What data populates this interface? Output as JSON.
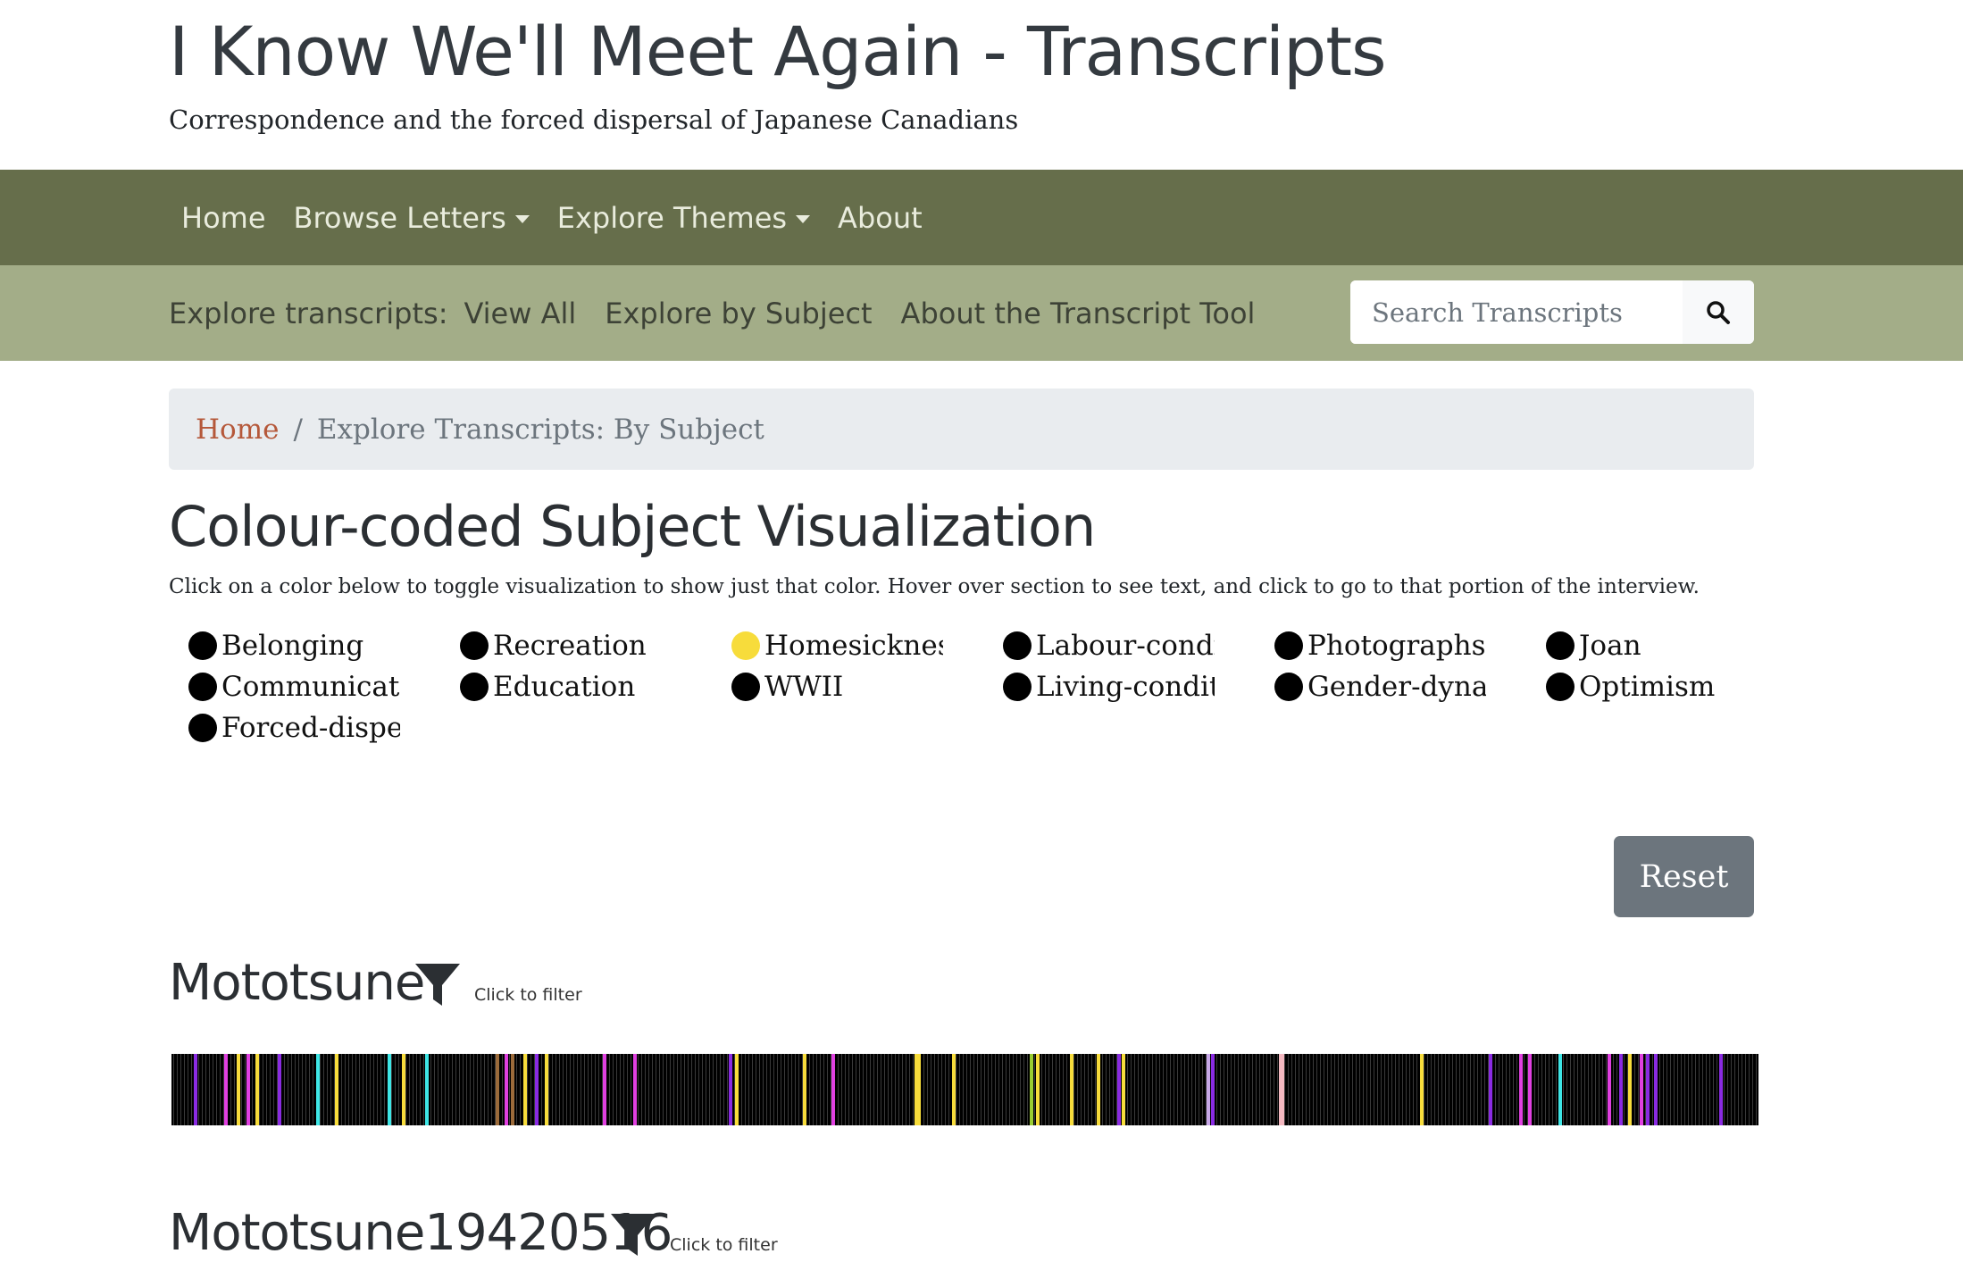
{
  "site": {
    "title": "I Know We'll Meet Again - Transcripts",
    "subtitle": "Correspondence and the forced dispersal of Japanese Canadians"
  },
  "main_nav": {
    "home": "Home",
    "browse_letters": "Browse Letters",
    "explore_themes": "Explore Themes",
    "about": "About"
  },
  "sub_nav": {
    "label": "Explore transcripts:",
    "view_all": "View All",
    "explore_by_subject": "Explore by Subject",
    "about_tool": "About the Transcript Tool",
    "search_placeholder": "Search Transcripts",
    "search_icon": "search-icon"
  },
  "breadcrumb": {
    "home": "Home",
    "separator": "/",
    "current": "Explore Transcripts: By Subject"
  },
  "page": {
    "title": "Colour-coded Subject Visualization",
    "instructions": "Click on a color below to toggle visualization to show just that color. Hover over section to see text, and click to go to that portion of the interview."
  },
  "legend": [
    {
      "label": "Belonging",
      "color": "#000000"
    },
    {
      "label": "Recreation",
      "color": "#000000"
    },
    {
      "label": "Homesickness",
      "color": "#f7dc3b"
    },
    {
      "label": "Labour-conditions",
      "color": "#000000"
    },
    {
      "label": "Photographs",
      "color": "#000000"
    },
    {
      "label": "Joan",
      "color": "#000000"
    },
    {
      "label": "Communication",
      "color": "#000000"
    },
    {
      "label": "Education",
      "color": "#000000"
    },
    {
      "label": "WWII",
      "color": "#000000"
    },
    {
      "label": "Living-conditions",
      "color": "#000000"
    },
    {
      "label": "Gender-dynamics",
      "color": "#000000"
    },
    {
      "label": "Optimism",
      "color": "#000000"
    },
    {
      "label": "Forced-dispersal",
      "color": "#000000"
    }
  ],
  "reset_label": "Reset",
  "sections": [
    {
      "name": "Mototsune",
      "filter_hint": "Click to filter",
      "filter_icon": "filter-icon"
    },
    {
      "name": "Mototsune19420516",
      "filter_hint": "Click to filter",
      "filter_icon": "filter-icon"
    }
  ],
  "colors": {
    "main_nav_bg": "#666e4b",
    "sub_nav_bg": "#a3ad88",
    "link_accent": "#b5583a",
    "reset_bg": "#6c757d",
    "highlight_yellow": "#f7dc3b",
    "highlight_magenta": "#e040e0",
    "highlight_purple": "#8a2be2",
    "highlight_cyan": "#3ee6e6",
    "highlight_brown": "#9c6b3a",
    "highlight_green": "#9acd32",
    "highlight_lavender": "#c8a8e8",
    "highlight_pink": "#f4b8c0"
  },
  "visualization_segments": [
    {
      "pos": 0.014,
      "color": "purple"
    },
    {
      "pos": 0.033,
      "color": "magenta"
    },
    {
      "pos": 0.041,
      "color": "yellow"
    },
    {
      "pos": 0.047,
      "color": "magenta"
    },
    {
      "pos": 0.053,
      "color": "yellow"
    },
    {
      "pos": 0.067,
      "color": "purple"
    },
    {
      "pos": 0.091,
      "color": "cyan"
    },
    {
      "pos": 0.103,
      "color": "yellow"
    },
    {
      "pos": 0.136,
      "color": "cyan"
    },
    {
      "pos": 0.145,
      "color": "yellow"
    },
    {
      "pos": 0.16,
      "color": "cyan"
    },
    {
      "pos": 0.204,
      "color": "brown"
    },
    {
      "pos": 0.21,
      "color": "magenta"
    },
    {
      "pos": 0.214,
      "color": "brown"
    },
    {
      "pos": 0.222,
      "color": "yellow"
    },
    {
      "pos": 0.229,
      "color": "purple"
    },
    {
      "pos": 0.235,
      "color": "yellow"
    },
    {
      "pos": 0.272,
      "color": "magenta"
    },
    {
      "pos": 0.291,
      "color": "magenta"
    },
    {
      "pos": 0.351,
      "color": "purple"
    },
    {
      "pos": 0.355,
      "color": "yellow"
    },
    {
      "pos": 0.398,
      "color": "yellow"
    },
    {
      "pos": 0.416,
      "color": "magenta"
    },
    {
      "pos": 0.468,
      "color": "yellow"
    },
    {
      "pos": 0.492,
      "color": "yellow"
    },
    {
      "pos": 0.47,
      "color": "yellow"
    },
    {
      "pos": 0.541,
      "color": "green"
    },
    {
      "pos": 0.566,
      "color": "yellow"
    },
    {
      "pos": 0.545,
      "color": "yellow"
    },
    {
      "pos": 0.596,
      "color": "purple"
    },
    {
      "pos": 0.599,
      "color": "yellow"
    },
    {
      "pos": 0.652,
      "color": "lavender"
    },
    {
      "pos": 0.583,
      "color": "yellow"
    },
    {
      "pos": 0.698,
      "color": "pink"
    },
    {
      "pos": 0.655,
      "color": "purple"
    },
    {
      "pos": 0.787,
      "color": "yellow"
    },
    {
      "pos": 0.83,
      "color": "purple"
    },
    {
      "pos": 0.849,
      "color": "magenta"
    },
    {
      "pos": 0.855,
      "color": "magenta"
    },
    {
      "pos": 0.874,
      "color": "cyan"
    },
    {
      "pos": 0.905,
      "color": "magenta"
    },
    {
      "pos": 0.912,
      "color": "purple"
    },
    {
      "pos": 0.918,
      "color": "yellow"
    },
    {
      "pos": 0.925,
      "color": "magenta"
    },
    {
      "pos": 0.929,
      "color": "purple"
    },
    {
      "pos": 0.934,
      "color": "purple"
    },
    {
      "pos": 0.975,
      "color": "purple"
    }
  ]
}
